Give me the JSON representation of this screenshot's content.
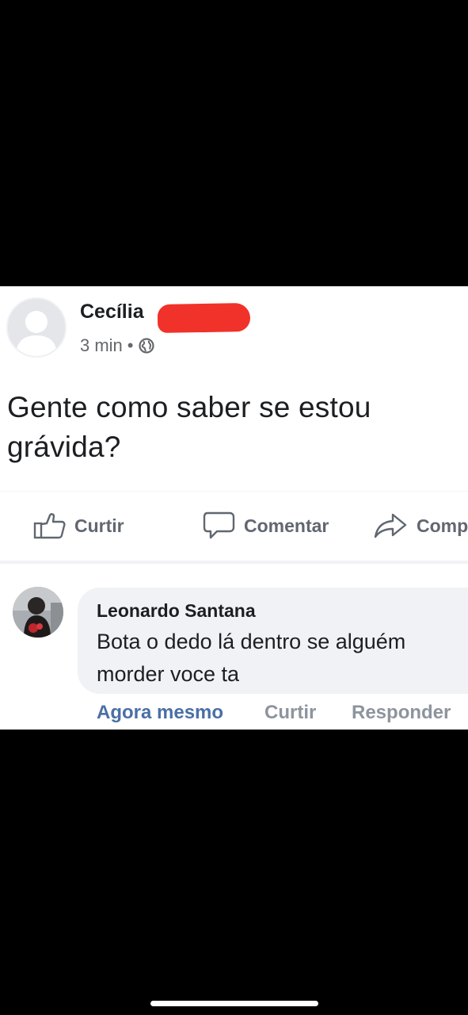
{
  "post": {
    "author": "Cecília",
    "time": "3 min",
    "separator": "•",
    "privacy_icon": "globe-icon",
    "text": "Gente como saber se estou grávida?",
    "redaction_color": "#f0322a"
  },
  "actions": {
    "like_label": "Curtir",
    "comment_label": "Comentar",
    "share_label": "Comp",
    "like_icon": "thumbs-up-icon",
    "comment_icon": "speech-bubble-icon",
    "share_icon": "share-arrow-icon"
  },
  "comment": {
    "author": "Leonardo Santana",
    "text": "Bota o dedo lá dentro se alguém morder voce ta",
    "time": "Agora mesmo",
    "like_label": "Curtir",
    "reply_label": "Responder"
  },
  "colors": {
    "background": "#000000",
    "card": "#ffffff",
    "text": "#1c1e21",
    "muted": "#65676b",
    "bubble": "#f0f2f5",
    "time_link": "#4a6fa5"
  }
}
